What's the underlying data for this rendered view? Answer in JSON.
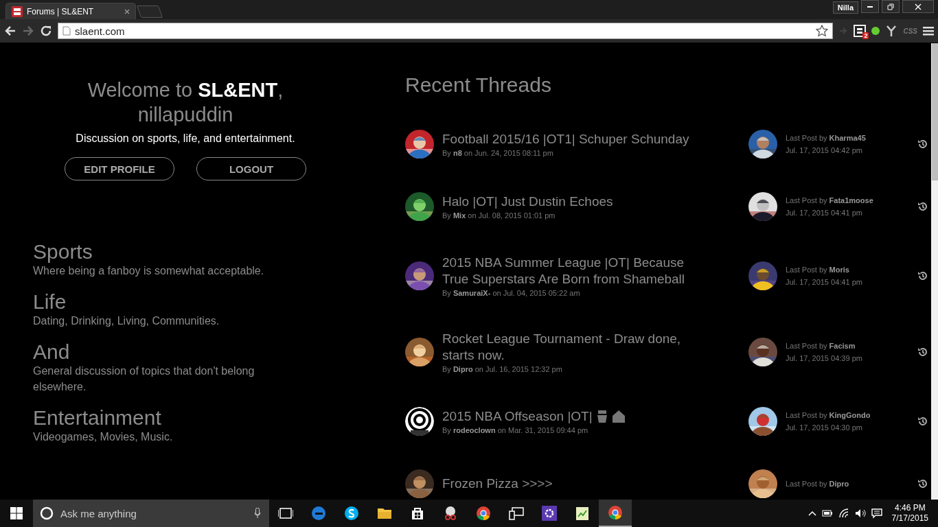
{
  "browser": {
    "tab": {
      "title": "Forums | SL&ENT",
      "selected": true
    },
    "profile": "Nilla",
    "address": "slaent.com",
    "extension_badge": "2",
    "extension_label": "CSS"
  },
  "welcome": {
    "heading": "Welcome to **SL&ENT**,",
    "user": "nillapuddin",
    "tagline": "Discussion on sports, life, and entertainment.",
    "buttons": [
      "EDIT PROFILE",
      "LOGOUT"
    ]
  },
  "categories": [
    {
      "title": "Sports",
      "description": "Where being a fanboy is somewhat acceptable."
    },
    {
      "title": "Life",
      "description": "Dating, Drinking, Living, Communities."
    },
    {
      "title": "And",
      "description": "General discussion of topics that don't belong elsewhere."
    },
    {
      "title": "Entertainment",
      "description": "Videogames, Movies, Music."
    }
  ],
  "recent_threads": {
    "heading": "Recent Threads",
    "threads": [
      {
        "title": "Football 2015/16 |OT1| Schuper Schunday",
        "byline": "By **n8** on Jun. 24, 2015 08:11 pm",
        "last_post": "Last Post by **Kharma45**",
        "last_date": "Jul. 17, 2015 04:42 pm"
      },
      {
        "title": "Halo |OT| Just Dustin Echoes",
        "byline": "By **Mix** on Jul. 08, 2015 01:01 pm",
        "last_post": "Last Post by **Fata1moose**",
        "last_date": "Jul. 17, 2015 04:41 pm"
      },
      {
        "title": "2015 NBA Summer League |OT| Because True Superstars Are Born from Shameball",
        "byline": "By **SamuraiX-** on Jul. 04, 2015 05:22 am",
        "last_post": "Last Post by **Moris**",
        "last_date": "Jul. 17, 2015 04:41 pm"
      },
      {
        "title": "Rocket League Tournament - Draw done, starts now.",
        "byline": "By **Dipro** on Jul. 16, 2015 12:32 pm",
        "last_post": "Last Post by **Facism**",
        "last_date": "Jul. 17, 2015 04:39 pm"
      },
      {
        "title": "2015 NBA Offseason |OT|",
        "byline": "By **rodeoclown** on Mar. 31, 2015 09:44 pm",
        "last_post": "Last Post by **KingGondo**",
        "last_date": "Jul. 17, 2015 04:30 pm"
      },
      {
        "title": "Frozen Pizza >>>>",
        "last_post": "Last Post by **Dipro**"
      }
    ]
  },
  "taskbar": {
    "search_placeholder": "Ask me anything",
    "time": "4:46 PM",
    "date": "7/17/2015"
  }
}
